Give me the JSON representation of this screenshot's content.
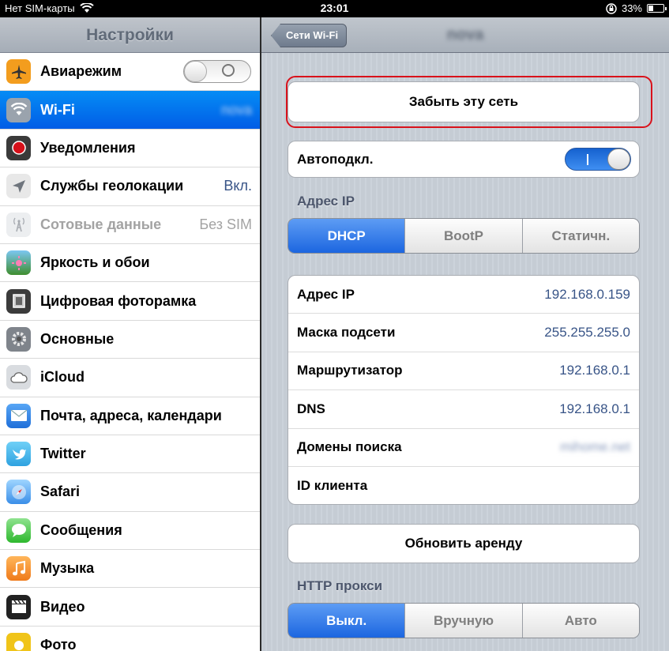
{
  "status": {
    "carrier": "Нет SIM-карты",
    "time": "23:01",
    "battery": "33%",
    "battery_level": 0.33
  },
  "sidebar": {
    "title": "Настройки",
    "items": [
      {
        "label": "Авиарежим",
        "icon": "airplane-icon",
        "color": "#f39d1e"
      },
      {
        "label": "Wi-Fi",
        "icon": "wifi-icon",
        "color": "#2a7de9",
        "value": "nova"
      },
      {
        "label": "Уведомления",
        "icon": "notifications-icon",
        "color": "#d5101a"
      },
      {
        "label": "Службы геолокации",
        "icon": "location-icon",
        "color": "#8a8f97",
        "value": "Вкл."
      },
      {
        "label": "Сотовые данные",
        "icon": "cellular-icon",
        "color": "#b8bcc2",
        "value": "Без SIM"
      },
      {
        "label": "Яркость и обои",
        "icon": "brightness-icon",
        "color": "#4c8e3c"
      },
      {
        "label": "Цифровая фоторамка",
        "icon": "photo-frame-icon",
        "color": "#3b3b3b"
      },
      {
        "label": "Основные",
        "icon": "gear-icon",
        "color": "#7f848b"
      },
      {
        "label": "iCloud",
        "icon": "icloud-icon",
        "color": "#c9ccd1"
      },
      {
        "label": "Почта, адреса, календари",
        "icon": "mail-icon",
        "color": "#1f6fd9"
      },
      {
        "label": "Twitter",
        "icon": "twitter-icon",
        "color": "#2fa2e0"
      },
      {
        "label": "Safari",
        "icon": "safari-icon",
        "color": "#3a8ee8"
      },
      {
        "label": "Сообщения",
        "icon": "messages-icon",
        "color": "#2eb82e"
      },
      {
        "label": "Музыка",
        "icon": "music-icon",
        "color": "#ef7a1a"
      },
      {
        "label": "Видео",
        "icon": "video-icon",
        "color": "#222222"
      },
      {
        "label": "Фото",
        "icon": "photos-icon",
        "color": "#f0c419"
      }
    ]
  },
  "detail": {
    "back_label": "Сети Wi-Fi",
    "title": "nova",
    "forget_label": "Забыть эту сеть",
    "autojoin_label": "Автоподкл.",
    "ip_section": "Адрес IP",
    "ip_modes": [
      "DHCP",
      "BootP",
      "Статичн."
    ],
    "rows": [
      {
        "label": "Адрес IP",
        "value": "192.168.0.159"
      },
      {
        "label": "Маска подсети",
        "value": "255.255.255.0"
      },
      {
        "label": "Маршрутизатор",
        "value": "192.168.0.1"
      },
      {
        "label": "DNS",
        "value": "192.168.0.1"
      },
      {
        "label": "Домены поиска",
        "value": "mihome.net"
      },
      {
        "label": "ID клиента",
        "value": ""
      }
    ],
    "renew_label": "Обновить аренду",
    "proxy_section": "HTTP прокси",
    "proxy_modes": [
      "Выкл.",
      "Вручную",
      "Авто"
    ]
  },
  "colors": {
    "accent": "#1c66e0",
    "highlight_red": "#d9121b"
  }
}
